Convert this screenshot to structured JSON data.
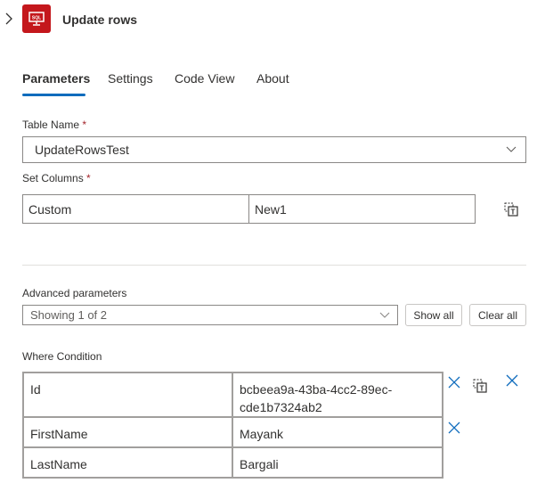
{
  "header": {
    "title": "Update rows",
    "app_icon": "sql-icon",
    "expand_icon": "chevron-right-icon",
    "icon_color": "#c4171c"
  },
  "tabs": [
    {
      "label": "Parameters",
      "active": true
    },
    {
      "label": "Settings",
      "active": false
    },
    {
      "label": "Code View",
      "active": false
    },
    {
      "label": "About",
      "active": false
    }
  ],
  "table_name": {
    "label": "Table Name",
    "required_mark": "*",
    "value": "UpdateRowsTest"
  },
  "set_columns": {
    "label": "Set Columns",
    "required_mark": "*",
    "key": "Custom",
    "value": "New1",
    "switch_icon": "switch-to-text-mode-icon"
  },
  "advanced": {
    "label": "Advanced parameters",
    "value": "Showing 1 of 2",
    "show_all_label": "Show all",
    "clear_all_label": "Clear all"
  },
  "where_condition": {
    "label": "Where Condition",
    "rows": [
      {
        "key": "Id",
        "value": "bcbeea9a-43ba-4cc2-89ec-cde1b7324ab2"
      },
      {
        "key": "FirstName",
        "value": "Mayank"
      },
      {
        "key": "LastName",
        "value": "Bargali"
      }
    ]
  },
  "colors": {
    "accent": "#0f6cbd",
    "required": "#a4262c"
  }
}
